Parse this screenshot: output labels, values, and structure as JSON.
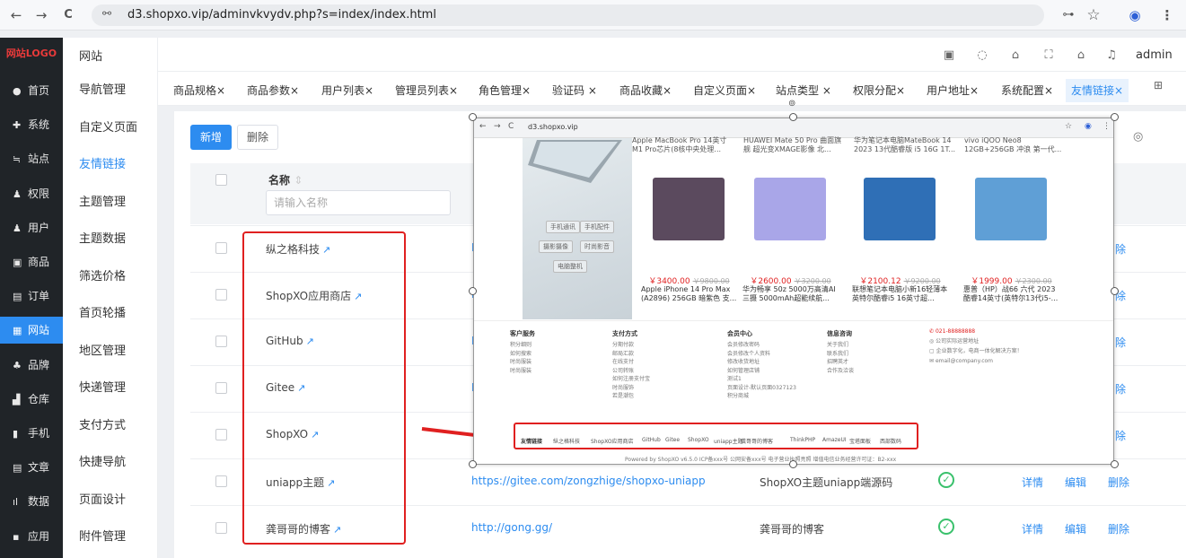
{
  "browser": {
    "url": "d3.shopxo.vip/adminvkvydv.php?s=index/index.html",
    "back_icon": "←",
    "forward_icon": "→",
    "reload_icon": "C",
    "site_icon": "⚯",
    "key_icon": "⊶",
    "star_icon": "☆",
    "profile_icon": "◉",
    "menu_icon": "⋮"
  },
  "logo": "网站LOGO",
  "nav": [
    {
      "icon": "●",
      "label": "首页"
    },
    {
      "icon": "✚",
      "label": "系统"
    },
    {
      "icon": "≒",
      "label": "站点"
    },
    {
      "icon": "♟",
      "label": "权限"
    },
    {
      "icon": "♟",
      "label": "用户"
    },
    {
      "icon": "▣",
      "label": "商品"
    },
    {
      "icon": "▤",
      "label": "订单"
    },
    {
      "icon": "▦",
      "label": "网站"
    },
    {
      "icon": "♣",
      "label": "品牌"
    },
    {
      "icon": "▟",
      "label": "仓库"
    },
    {
      "icon": "▮",
      "label": "手机"
    },
    {
      "icon": "▤",
      "label": "文章"
    },
    {
      "icon": "ıl",
      "label": "数据"
    },
    {
      "icon": "▪",
      "label": "应用"
    }
  ],
  "subnav": {
    "title": "网站",
    "items": [
      "导航管理",
      "自定义页面",
      "友情链接",
      "主题管理",
      "主题数据",
      "筛选价格",
      "首页轮播",
      "地区管理",
      "快递管理",
      "支付方式",
      "快捷导航",
      "页面设计",
      "附件管理"
    ]
  },
  "header": {
    "user": "admin"
  },
  "tabs": [
    "商品规格×",
    "商品参数×",
    "用户列表×",
    "管理员列表×",
    "角色管理×",
    "验证码 ×",
    "商品收藏×",
    "自定义页面×",
    "站点类型 ×",
    "权限分配×",
    "用户地址×",
    "系统配置×",
    "友情链接×"
  ],
  "toolbar": {
    "add": "新增",
    "delete": "删除"
  },
  "table": {
    "col_name": "名称",
    "name_placeholder": "请输入名称",
    "rows": [
      {
        "name": "纵之格科技",
        "url": "I",
        "desc": "",
        "actions": [
          "除"
        ]
      },
      {
        "name": "ShopXO应用商店",
        "url": "I",
        "desc": "",
        "actions": [
          "除"
        ]
      },
      {
        "name": "GitHub",
        "url": "I",
        "desc": "",
        "actions": [
          "除"
        ]
      },
      {
        "name": "Gitee",
        "url": "I",
        "desc": "",
        "actions": [
          "除"
        ]
      },
      {
        "name": "ShopXO",
        "url": "",
        "desc": "",
        "actions": [
          "除"
        ]
      },
      {
        "name": "uniapp主题",
        "url": "https://gitee.com/zongzhige/shopxo-uniapp",
        "desc": "ShopXO主题uniapp端源码",
        "actions": [
          "详情",
          "编辑",
          "删除"
        ]
      },
      {
        "name": "龚哥哥的博客",
        "url": "http://gong.gg/",
        "desc": "龚哥哥的博客",
        "actions": [
          "详情",
          "编辑",
          "删除"
        ]
      }
    ]
  },
  "overlay": {
    "url": "d3.shopxo.vip",
    "top_titles": [
      "Apple MacBook Pro 14英寸\nM1 Pro芯片(8核中央处理...",
      "HUAWEI Mate 50 Pro 曲面旗\n舰 超光变XMAGE影像 北...",
      "华为笔记本电脑MateBook 14\n2023 13代酷睿版 i5 16G 1T...",
      "vivo iQOO Neo8\n12GB+256GB 冲浪 第一代..."
    ],
    "hero_tags": [
      "手机通讯",
      "手机配件",
      "摄影摄像",
      "时尚影音",
      "电脑整机"
    ],
    "products": [
      {
        "price": "￥3400.00",
        "old": "￥9800.00",
        "title": "Apple iPhone 14 Pro Max (A2896) 256GB 暗紫色 支...",
        "color": "#5b4a5e"
      },
      {
        "price": "￥2600.00",
        "old": "￥3200.00",
        "title": "华为畅享 50z 5000万高清AI三摄 5000mAh超能续航...",
        "color": "#a9a6e8"
      },
      {
        "price": "￥2100.12",
        "old": "￥9200.00",
        "title": "联想笔记本电脑小新16轻薄本 英特尔酷睿i5 16英寸超...",
        "color": "#2f6fb6"
      },
      {
        "price": "￥1999.00",
        "old": "￥2300.00",
        "title": "惠普（HP）战66 六代 2023酷睿14英寸(英特尔13代i5-...",
        "color": "#5f9fd6"
      }
    ],
    "footer_cols": [
      {
        "head": "客户服务",
        "items": [
          "积分细则",
          "如何搜索",
          "时尚服装",
          "时尚服装"
        ]
      },
      {
        "head": "支付方式",
        "items": [
          "分期付款",
          "邮局汇款",
          "在线支付",
          "公司转账",
          "如何注册支付宝",
          "时尚服饰",
          "若是潮包"
        ]
      },
      {
        "head": "会员中心",
        "items": [
          "会员修改密码",
          "会员修改个人资料",
          "修改收货地址",
          "如何管理店铺",
          "测试1",
          "页面设计-默认页面0327123",
          "积分商城"
        ]
      },
      {
        "head": "信息咨询",
        "items": [
          "关于我们",
          "联系我们",
          "招聘英才",
          "合作及洽谈"
        ]
      }
    ],
    "contact": [
      "021-88888888",
      "公司实际运营地址",
      "企业数字化，电商一体化解决方案！",
      "email@company.com"
    ],
    "links_label": "友情链接",
    "links": [
      "纵之格科技",
      "ShopXO应用商店",
      "GitHub",
      "Gitee",
      "ShopXO",
      "uniapp主题",
      "龚哥哥的博客",
      "ThinkPHP",
      "AmazeUI",
      "宝塔面板",
      "西部数码"
    ],
    "powered": "Powered by ShopXO v6.5.0    ICP备xxx号    公网安备xxx号    电子营业执照亮照    增值电信业务经营许可证：B2-xxx"
  }
}
